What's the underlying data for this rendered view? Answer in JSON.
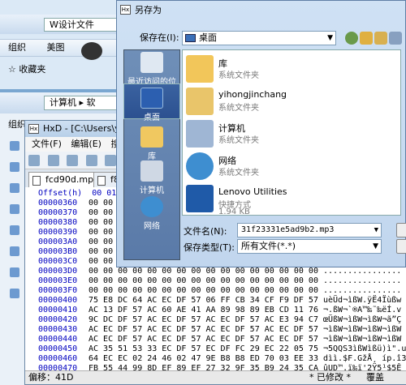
{
  "explorer1": {
    "crumb": "W设计文件",
    "org_label": "组织",
    "beautify_label": "美图",
    "favorites_label": "收藏夹"
  },
  "explorer2": {
    "crumb_root": "计算机",
    "crumb_next": "软",
    "org_label": "组织"
  },
  "hxd": {
    "title": "HxD - [C:\\Users\\yihon",
    "menu": [
      "文件(F)",
      "编辑(E)",
      "搜"
    ],
    "tabs": [
      "fcd90d.mp3",
      "f8"
    ],
    "header": "Offset(h)  00 01",
    "rows": [
      {
        "off": "00000360",
        "bytes": "00 00",
        "ascii": ""
      },
      {
        "off": "00000370",
        "bytes": "00 00",
        "ascii": ""
      },
      {
        "off": "00000380",
        "bytes": "00 00",
        "ascii": ""
      },
      {
        "off": "00000390",
        "bytes": "00 00",
        "ascii": ""
      },
      {
        "off": "000003A0",
        "bytes": "00 00",
        "ascii": ""
      },
      {
        "off": "000003B0",
        "bytes": "00 00",
        "ascii": ""
      },
      {
        "off": "000003C0",
        "bytes": "00 00",
        "ascii": ""
      },
      {
        "off": "000003D0",
        "bytes": "00 00 00 00 00 00 00 00 00 00 00 00 00 00 00 00",
        "ascii": "................"
      },
      {
        "off": "000003E0",
        "bytes": "00 00 00 00 00 00 00 00 00 00 00 00 00 00 00 00",
        "ascii": "................"
      },
      {
        "off": "000003F0",
        "bytes": "00 00 00 00 00 00 00 00 00 00 00 00 00 00 00 00",
        "ascii": "................"
      },
      {
        "off": "00000400",
        "bytes": "75 E8 DC 64 AC EC DF 57 06 FF CB 34 CF F9 DF 57",
        "ascii": "uèÜd¬ìßW.ÿË4Ïùßw"
      },
      {
        "off": "00000410",
        "bytes": "AC 13 DF 57 AC 60 AE 41 AA 89 98 89 EB CD 11 76",
        "ascii": "¬.ßW¬`®A™‰˜‰ëÍ.v"
      },
      {
        "off": "00000420",
        "bytes": "9C DC DF 57 AC EC DF 57 AC EC DF 57 AC E3 94 C7",
        "ascii": "œÜßW¬ìßW¬ìßW¬ã”Ç"
      },
      {
        "off": "00000430",
        "bytes": "AC EC DF 57 AC EC DF 57 AC EC DF 57 AC EC DF 57",
        "ascii": "¬ìßW¬ìßW¬ìßW¬ìßW"
      },
      {
        "off": "00000440",
        "bytes": "AC EC DF 57 AC EC DF 57 AC EC DF 57 AC EC DF 57",
        "ascii": "¬ìßW¬ìßW¬ìßW¬ìßW"
      },
      {
        "off": "00000450",
        "bytes": "AC 35 51 53 33 EC DF 57 EC DF FC 29 EC 22 05 75",
        "ascii": "¬5QQS3ìßWìßü)ì\".u"
      },
      {
        "off": "00000460",
        "bytes": "64 EC EC 02 24 46 02 47 9E B8 B8 ED 70 03 EE 33",
        "ascii": "dìì.$F.GžÅ¸ íp.î3"
      },
      {
        "off": "00000470",
        "bytes": "FB 55 44 99 8D EF 89 EF 27 32 9F 35 B9 24 35 CA",
        "ascii": "ûUD™.ï‰ï'2Ÿ5¹$5Ê"
      }
    ],
    "status_offset": "偏移：41D",
    "status_modified": "* 已修改 *",
    "status_overwrite": "覆盖"
  },
  "dialog": {
    "title": "另存为",
    "save_in_label": "保存在(I):",
    "save_in_value": "桌面",
    "places": [
      "最近访问的位置",
      "桌面",
      "库",
      "计算机",
      "网络"
    ],
    "files": [
      {
        "name": "库",
        "sub": "系统文件夹",
        "sub2": ""
      },
      {
        "name": "yihongjinchang",
        "sub": "系统文件夹",
        "sub2": ""
      },
      {
        "name": "计算机",
        "sub": "系统文件夹",
        "sub2": ""
      },
      {
        "name": "网络",
        "sub": "系统文件夹",
        "sub2": ""
      },
      {
        "name": "Lenovo Utilities",
        "sub": "快捷方式",
        "sub2": "1.94 KB"
      }
    ],
    "filename_label": "文件名(N):",
    "filename_value": "31f23331e5ad9b2.mp3",
    "filetype_label": "保存类型(T):",
    "filetype_value": "所有文件(*.*)"
  }
}
